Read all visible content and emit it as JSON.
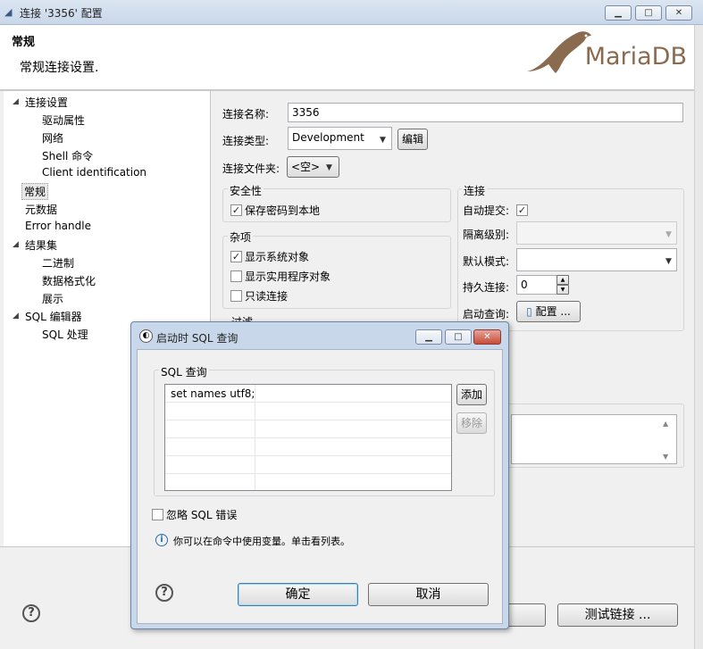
{
  "window": {
    "title": "连接 '3356' 配置",
    "minimize": "▁",
    "maximize": "□",
    "close": "✕"
  },
  "header": {
    "title": "常规",
    "description": "常规连接设置.",
    "logo": "MariaDB"
  },
  "tree": {
    "items": [
      {
        "label": "连接设置",
        "expanded": true
      },
      {
        "label": "驱动属性"
      },
      {
        "label": "网络"
      },
      {
        "label": "Shell 命令"
      },
      {
        "label": "Client identification"
      },
      {
        "label": "常规",
        "selected": true
      },
      {
        "label": "元数据"
      },
      {
        "label": "Error handle"
      },
      {
        "label": "结果集",
        "expanded": true
      },
      {
        "label": "二进制"
      },
      {
        "label": "数据格式化"
      },
      {
        "label": "展示"
      },
      {
        "label": "SQL 编辑器",
        "expanded": true
      },
      {
        "label": "SQL 处理"
      }
    ]
  },
  "form": {
    "conn_name_label": "连接名称:",
    "conn_name_value": "3356",
    "conn_type_label": "连接类型:",
    "conn_type_value": "Development",
    "edit_button": "编辑",
    "folder_label": "连接文件夹:",
    "folder_value": "<空>",
    "security": {
      "title": "安全性",
      "save_password": "保存密码到本地",
      "save_password_checked": true
    },
    "misc": {
      "title": "杂项",
      "show_system": "显示系统对象",
      "show_system_checked": true,
      "show_util": "显示实用程序对象",
      "show_util_checked": false,
      "readonly": "只读连接",
      "readonly_checked": false
    },
    "filter_partial": "过滤",
    "connection": {
      "title": "连接",
      "autocommit_label": "自动提交:",
      "autocommit_checked": true,
      "isolation_label": "隔离级别:",
      "isolation_value": "",
      "default_mode_label": "默认模式:",
      "default_mode_value": "",
      "keepalive_label": "持久连接:",
      "keepalive_value": "0",
      "bootstrap_label": "启动查询:",
      "configure_button": "配置 ..."
    }
  },
  "bottom": {
    "help": "?",
    "test_button": "测试链接 ..."
  },
  "dialog": {
    "title": "启动时 SQL 查询",
    "group_title": "SQL 查询",
    "queries": [
      "set names utf8;"
    ],
    "add_button": "添加",
    "remove_button": "移除",
    "ignore_errors_label": "忽略 SQL 错误",
    "ignore_errors_checked": false,
    "info_text": "你可以在命令中使用变量。单击看列表。",
    "help": "?",
    "ok_button": "确定",
    "cancel_button": "取消"
  }
}
